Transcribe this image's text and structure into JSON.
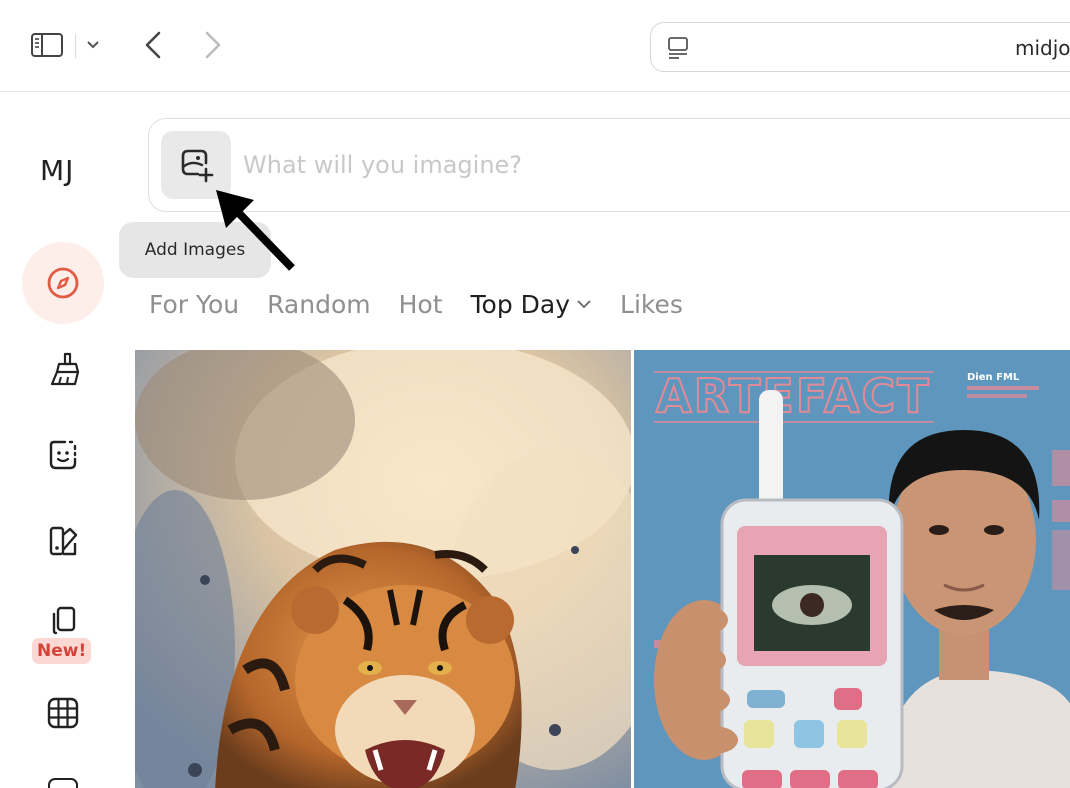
{
  "browser": {
    "url_fragment": "midjo",
    "icons": {
      "sidebar": "sidebar-toggle-icon",
      "chevron": "chevron-down-icon",
      "back": "chevron-left-icon",
      "forward": "chevron-right-icon",
      "address": "site-settings-icon"
    }
  },
  "app": {
    "brand": "MJ",
    "prompt": {
      "placeholder": "What will you imagine?",
      "value": ""
    },
    "tooltip": "Add Images",
    "sidebar": {
      "items": [
        {
          "name": "explore",
          "icon": "compass-icon",
          "active": true
        },
        {
          "name": "edit",
          "icon": "brush-icon"
        },
        {
          "name": "personalize",
          "icon": "face-icon"
        },
        {
          "name": "organize",
          "icon": "palette-book-icon"
        },
        {
          "name": "moodboards",
          "icon": "cards-icon",
          "badge": "New!"
        },
        {
          "name": "grid",
          "icon": "grid-icon"
        }
      ]
    },
    "tabs": [
      {
        "label": "For You",
        "active": false
      },
      {
        "label": "Random",
        "active": false
      },
      {
        "label": "Hot",
        "active": false
      },
      {
        "label": "Top Day",
        "active": true,
        "dropdown": true
      },
      {
        "label": "Likes",
        "active": false
      }
    ],
    "gallery": [
      {
        "subject": "tiger"
      },
      {
        "subject": "person holding device",
        "poster_text": "ARTEFACT",
        "side_text": [
          "Dien FML"
        ]
      }
    ],
    "accent_color": "#e25b45"
  }
}
